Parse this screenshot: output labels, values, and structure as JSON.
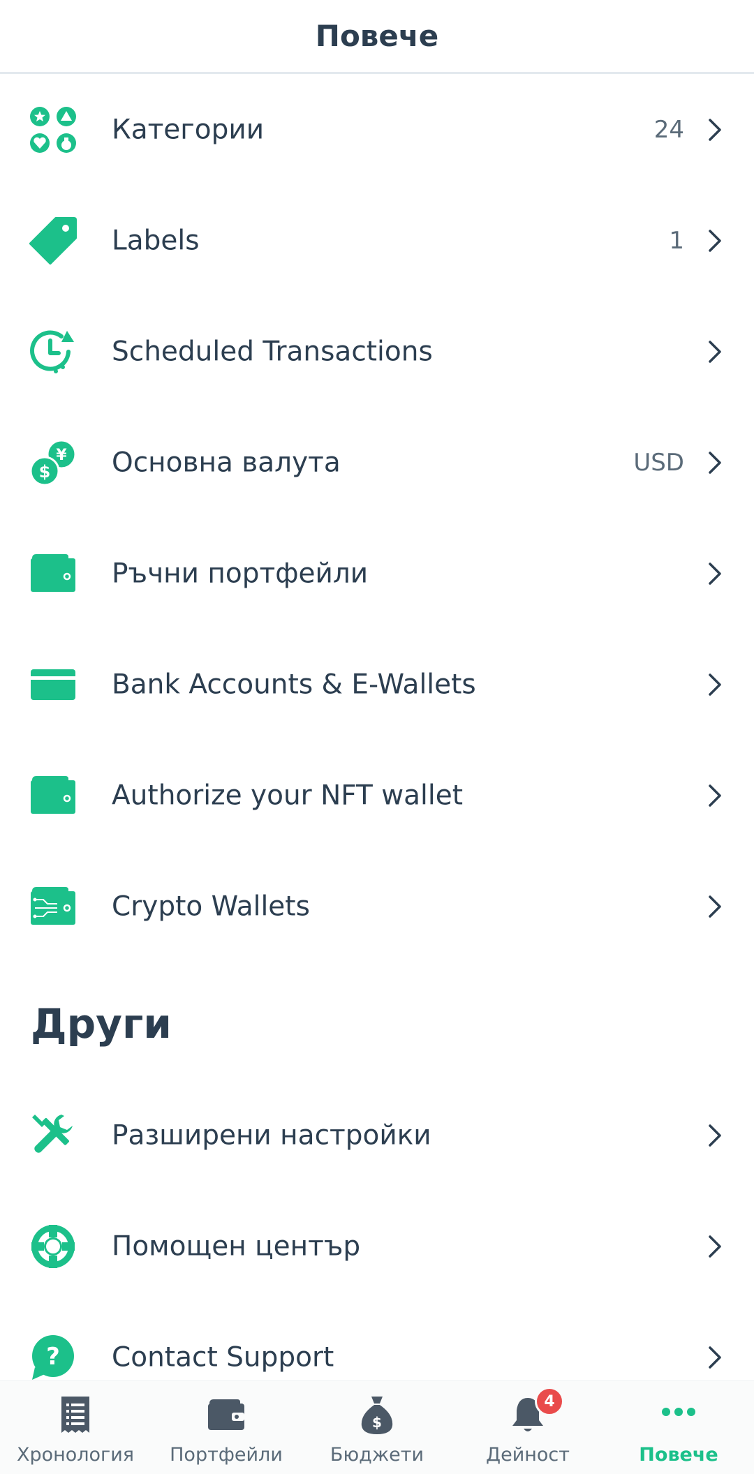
{
  "header": {
    "title": "Повече"
  },
  "colors": {
    "accent": "#1cc08a",
    "text": "#2c3e50",
    "muted": "#5b6b79",
    "badge": "#e94b4b"
  },
  "menu": [
    {
      "label": "Категории",
      "value": "24",
      "icon": "categories-icon"
    },
    {
      "label": "Labels",
      "value": "1",
      "icon": "tag-icon"
    },
    {
      "label": "Scheduled Transactions",
      "value": "",
      "icon": "scheduled-clock-icon"
    },
    {
      "label": "Основна валута",
      "value": "USD",
      "icon": "currency-icon"
    },
    {
      "label": "Ръчни портфейли",
      "value": "",
      "icon": "wallet-icon"
    },
    {
      "label": "Bank Accounts & E-Wallets",
      "value": "",
      "icon": "card-icon"
    },
    {
      "label": "Authorize your NFT wallet",
      "value": "",
      "icon": "wallet-icon"
    },
    {
      "label": "Crypto Wallets",
      "value": "",
      "icon": "crypto-wallet-icon"
    }
  ],
  "other": {
    "heading": "Други",
    "items": [
      {
        "label": "Разширени настройки",
        "value": "",
        "icon": "tools-icon"
      },
      {
        "label": "Помощен център",
        "value": "",
        "icon": "lifebuoy-icon"
      },
      {
        "label": "Contact Support",
        "value": "",
        "icon": "question-bubble-icon"
      }
    ]
  },
  "tabbar": {
    "tabs": [
      {
        "label": "Хронология",
        "icon": "receipt-icon"
      },
      {
        "label": "Портфейли",
        "icon": "wallet-icon"
      },
      {
        "label": "Бюджети",
        "icon": "money-bag-icon"
      },
      {
        "label": "Дейност",
        "icon": "bell-icon",
        "badge": "4"
      },
      {
        "label": "Повече",
        "icon": "more-dots-icon",
        "active": true
      }
    ]
  }
}
